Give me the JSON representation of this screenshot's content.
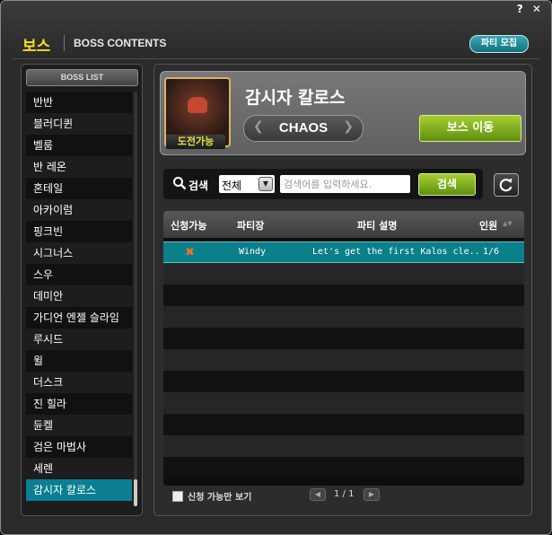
{
  "window": {
    "controls": "? ✕",
    "title": "보스",
    "subtitle": "BOSS CONTENTS",
    "party_recruit_label": "파티 모집"
  },
  "boss_list": {
    "header": "BOSS LIST",
    "items": [
      {
        "label": "반반"
      },
      {
        "label": "블러디퀸"
      },
      {
        "label": "벨룸"
      },
      {
        "label": "반 레온"
      },
      {
        "label": "혼테일"
      },
      {
        "label": "아카이럼"
      },
      {
        "label": "핑크빈"
      },
      {
        "label": "시그너스"
      },
      {
        "label": "스우"
      },
      {
        "label": "데미안"
      },
      {
        "label": "가디언 엔젤 슬라임"
      },
      {
        "label": "루시드"
      },
      {
        "label": "윌"
      },
      {
        "label": "더스크"
      },
      {
        "label": "진 힐라"
      },
      {
        "label": "듄켈"
      },
      {
        "label": "검은 마법사"
      },
      {
        "label": "세렌"
      },
      {
        "label": "감시자 칼로스"
      }
    ],
    "selected": "감시자 칼로스"
  },
  "boss_card": {
    "name": "감시자 칼로스",
    "badge": "도전가능",
    "difficulty": "CHAOS",
    "move_label": "보스 이동"
  },
  "search": {
    "label": "검색",
    "filter_value": "전체",
    "placeholder": "검색어를 입력하세요.",
    "button_label": "검색"
  },
  "table": {
    "columns": [
      "신청가능",
      "파티장",
      "파티 설명",
      "인원"
    ],
    "rows": [
      {
        "status": "✖",
        "leader": "Windy",
        "desc": "Let's get the first Kalos cle..",
        "members": "1/6"
      }
    ]
  },
  "footer": {
    "available_only_label": "신청 가능만 보기",
    "page_text": "1 / 1"
  },
  "colors": {
    "accent_teal": "#0a7f93",
    "title_yellow": "#f6e019",
    "button_green": "#7fae1f",
    "status_x": "#e9722e"
  }
}
